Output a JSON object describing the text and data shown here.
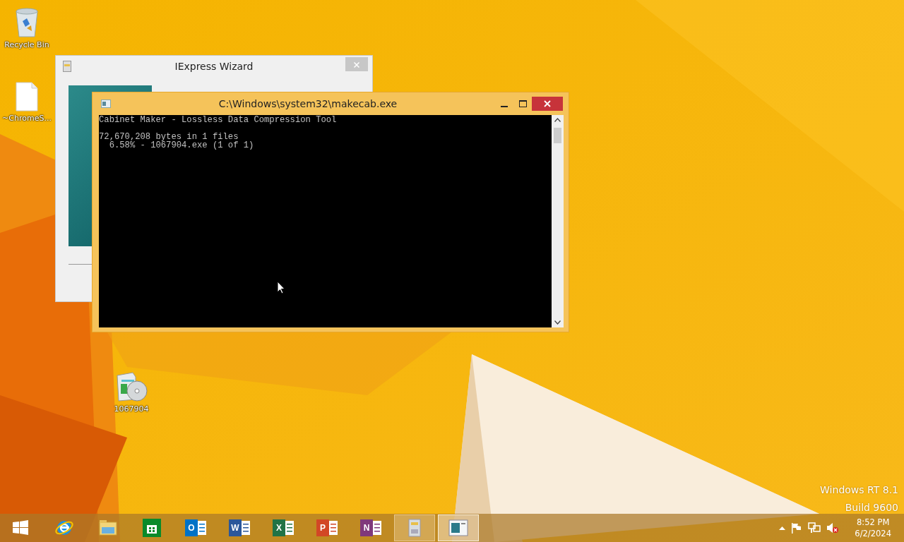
{
  "desktop_icons": [
    {
      "label": "Recycle Bin",
      "kind": "recycle"
    },
    {
      "label": "~ChromeS...",
      "kind": "file"
    },
    {
      "label": "1067904",
      "kind": "package"
    }
  ],
  "background_window": {
    "title": "IExpress Wizard"
  },
  "console_window": {
    "title": "C:\\Windows\\system32\\makecab.exe",
    "header": "Cabinet Maker - Lossless Data Compression Tool",
    "output_lines": [
      "72,670,208 bytes in 1 files",
      "  6.58% - 1067904.exe (1 of 1)"
    ]
  },
  "edition": {
    "name": "Windows RT 8.1",
    "build": "Build 9600"
  },
  "taskbar": {
    "apps": [
      {
        "kind": "start",
        "running": false,
        "selected": false
      },
      {
        "kind": "ie",
        "running": false,
        "selected": false
      },
      {
        "kind": "explorer",
        "running": false,
        "selected": false
      },
      {
        "kind": "store",
        "running": false,
        "selected": false
      },
      {
        "kind": "office",
        "letter": "O",
        "color": "#0072c6",
        "running": false,
        "selected": false
      },
      {
        "kind": "office",
        "letter": "W",
        "color": "#2b579a",
        "running": false,
        "selected": false
      },
      {
        "kind": "office",
        "letter": "X",
        "color": "#217346",
        "running": false,
        "selected": false
      },
      {
        "kind": "office",
        "letter": "P",
        "color": "#d24726",
        "running": false,
        "selected": false
      },
      {
        "kind": "office",
        "letter": "N",
        "color": "#80397b",
        "running": false,
        "selected": false
      },
      {
        "kind": "iexpress",
        "running": true,
        "selected": false
      },
      {
        "kind": "console",
        "running": true,
        "selected": true
      }
    ],
    "clock": {
      "time": "8:52 PM",
      "date": "6/2/2024"
    }
  }
}
